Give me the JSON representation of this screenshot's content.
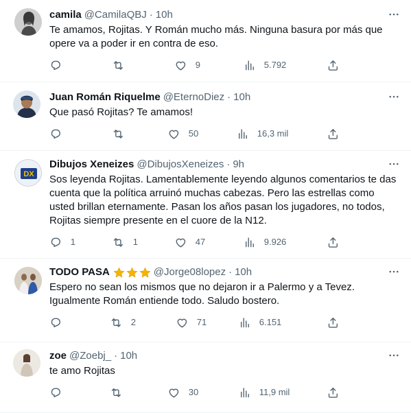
{
  "tweets": [
    {
      "name": "camila",
      "handle": "@CamilaQBJ",
      "dot": "·",
      "time": "10h",
      "text": "Te amamos, Rojitas. Y Román mucho más. Ninguna basura por más que opere va a poder ir en contra de eso.",
      "replies": "",
      "retweets": "",
      "likes": "9",
      "views": "5.792"
    },
    {
      "name": "Juan Román Riquelme",
      "handle": "@EternoDiez",
      "dot": "·",
      "time": "10h",
      "text": "Que pasó Rojitas? Te amamos!",
      "replies": "",
      "retweets": "",
      "likes": "50",
      "views": "16,3 mil"
    },
    {
      "name": "Dibujos Xeneizes",
      "handle": "@DibujosXeneizes",
      "dot": "·",
      "time": "9h",
      "text": "Sos leyenda Rojitas. Lamentablemente leyendo algunos comentarios te das cuenta que la política arruinó muchas cabezas. Pero las estrellas como usted brillan eternamente. Pasan los años pasan los jugadores, no todos, Rojitas siempre presente en el cuore de la N12.",
      "replies": "1",
      "retweets": "1",
      "likes": "47",
      "views": "9.926",
      "avatar_text": "DX"
    },
    {
      "name": "TODO PASA",
      "handle": "@Jorge08lopez",
      "dot": "·",
      "time": "10h",
      "text": "Espero no sean los mismos que no dejaron ir a Palermo y a Tevez. Igualmente Román entiende todo. Saludo bostero.",
      "replies": "",
      "retweets": "2",
      "likes": "71",
      "views": "6.151"
    },
    {
      "name": "zoe",
      "handle": "@Zoebj_",
      "dot": "·",
      "time": "10h",
      "text": "te amo Rojitas",
      "replies": "",
      "retweets": "",
      "likes": "30",
      "views": "11,9 mil"
    }
  ],
  "icons": {
    "more": "more-horizontal-icon",
    "reply": "reply-icon",
    "retweet": "retweet-icon",
    "like": "heart-icon",
    "views": "views-chart-icon",
    "share": "share-icon",
    "star": "star-emoji-icon"
  },
  "colors": {
    "text": "#0f1419",
    "secondary": "#536471",
    "divider": "#eff3f4",
    "star": "#f4b400"
  }
}
